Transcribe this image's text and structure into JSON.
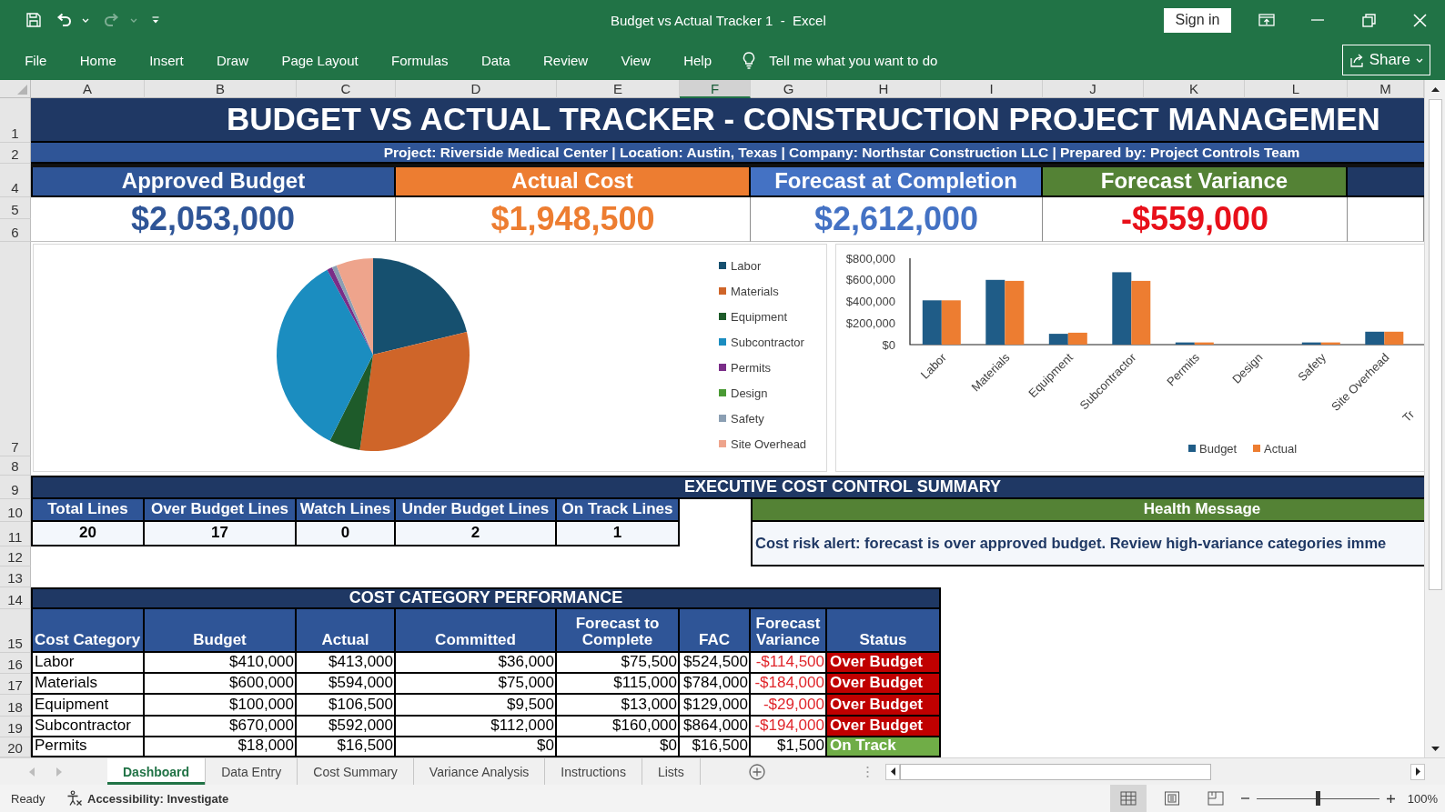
{
  "window": {
    "quick_access": [
      {
        "kind": "save",
        "disabled": false
      },
      {
        "kind": "undo",
        "disabled": false
      },
      {
        "kind": "redo",
        "disabled": true
      },
      {
        "kind": "customize",
        "disabled": false
      }
    ],
    "title": "Budget vs Actual Tracker 1  -  Excel",
    "sign_in": "Sign in"
  },
  "ribbon": {
    "tabs": [
      "File",
      "Home",
      "Insert",
      "Draw",
      "Page Layout",
      "Formulas",
      "Data",
      "Review",
      "View",
      "Help"
    ],
    "tell_me": "Tell me what you want to do",
    "share": "Share"
  },
  "columns": [
    {
      "label": "A",
      "selected": false
    },
    {
      "label": "B",
      "selected": false
    },
    {
      "label": "C",
      "selected": false
    },
    {
      "label": "D",
      "selected": false
    },
    {
      "label": "E",
      "selected": false
    },
    {
      "label": "F",
      "selected": true
    },
    {
      "label": "G",
      "selected": false
    },
    {
      "label": "H",
      "selected": false
    },
    {
      "label": "I",
      "selected": false
    },
    {
      "label": "J",
      "selected": false
    },
    {
      "label": "K",
      "selected": false
    },
    {
      "label": "L",
      "selected": false
    },
    {
      "label": "M",
      "selected": false
    }
  ],
  "row_numbers": [
    "1",
    "2",
    "4",
    "5",
    "6",
    "7",
    "8",
    "9",
    "10",
    "11",
    "12",
    "13",
    "14",
    "15",
    "16",
    "17",
    "18",
    "19",
    "20"
  ],
  "title": "BUDGET VS ACTUAL TRACKER - CONSTRUCTION PROJECT MANAGEMEN",
  "subtitle": "Project: Riverside Medical Center | Location: Austin, Texas | Company: Northstar Construction LLC | Prepared by: Project Controls Team",
  "kpis": [
    {
      "label": "Approved Budget",
      "color": "#2f5597",
      "value": {
        "text": "$2,053,000",
        "color": "#2f5597"
      }
    },
    {
      "label": "Actual Cost",
      "color": "#ed7d31",
      "value": {
        "text": "$1,948,500",
        "color": "#ed7d31"
      }
    },
    {
      "label": "Forecast at Completion",
      "color": "#4472c4",
      "value": {
        "text": "$2,612,000",
        "color": "#4472c4"
      }
    },
    {
      "label": "Forecast Variance",
      "color": "#548235",
      "value": {
        "text": "-$559,000",
        "color": "#e8101a"
      }
    },
    {
      "color": "#1f3864"
    }
  ],
  "pie_chart": {
    "chart_data": {
      "type": "pie",
      "categories": [
        "Labor",
        "Materials",
        "Equipment",
        "Subcontractor",
        "Permits",
        "Design",
        "Safety",
        "Site Overhead"
      ],
      "values": [
        21.2,
        31.0,
        5.2,
        34.7,
        0.9,
        0,
        0.8,
        6.2
      ],
      "colors": [
        "#16506f",
        "#cf6529",
        "#1e5b2a",
        "#1b8dc0",
        "#7a2d88",
        "#4a9a34",
        "#8b9fb3",
        "#eea48c"
      ],
      "legend": "right"
    }
  },
  "bar_chart": {
    "chart_data": {
      "type": "bar",
      "categories": [
        "Labor",
        "Materials",
        "Equipment",
        "Subcontractor",
        "Permits",
        "Design",
        "Safety",
        "Site Overhead"
      ],
      "series": [
        {
          "name": "Budget",
          "color": "#1f5c87",
          "values": [
            410000,
            600000,
            100000,
            670000,
            20000,
            0,
            20000,
            120000
          ]
        },
        {
          "name": "Actual",
          "color": "#ed7d31",
          "values": [
            410000,
            590000,
            110000,
            590000,
            20000,
            0,
            20000,
            120000
          ]
        }
      ],
      "ylim": [
        0,
        800000
      ],
      "yticks": [
        {
          "value": 0,
          "label": "$0"
        },
        {
          "value": 200000,
          "label": "$200,000"
        },
        {
          "value": 400000,
          "label": "$400,000"
        },
        {
          "value": 600000,
          "label": "$600,000"
        },
        {
          "value": 800000,
          "label": "$800,000"
        }
      ],
      "legend": "bottom",
      "annotations": [
        "Tr"
      ]
    }
  },
  "summary": {
    "title": "EXECUTIVE COST CONTROL SUMMARY",
    "columns": [
      "Total Lines",
      "Over Budget Lines",
      "Watch Lines",
      "Under Budget Lines",
      "On Track Lines"
    ],
    "values": [
      "20",
      "17",
      "0",
      "2",
      "1"
    ],
    "health_title": "Health Message",
    "health_message": "Cost risk alert: forecast is over approved budget. Review high-variance categories imme"
  },
  "performance": {
    "title": "COST CATEGORY PERFORMANCE",
    "columns": [
      "Cost Category",
      "Budget",
      "Actual",
      "Committed",
      "Forecast to Complete",
      "FAC",
      "Forecast Variance",
      "Status"
    ],
    "rows": [
      {
        "cells": [
          "Labor",
          "$410,000",
          "$413,000",
          "$36,000",
          "$75,500",
          "$524,500",
          "-$114,500"
        ],
        "variance_negative": true,
        "status": "Over Budget",
        "kind": "over_budget"
      },
      {
        "cells": [
          "Materials",
          "$600,000",
          "$594,000",
          "$75,000",
          "$115,000",
          "$784,000",
          "-$184,000"
        ],
        "variance_negative": true,
        "status": "Over Budget",
        "kind": "over_budget"
      },
      {
        "cells": [
          "Equipment",
          "$100,000",
          "$106,500",
          "$9,500",
          "$13,000",
          "$129,000",
          "-$29,000"
        ],
        "variance_negative": true,
        "status": "Over Budget",
        "kind": "over_budget"
      },
      {
        "cells": [
          "Subcontractor",
          "$670,000",
          "$592,000",
          "$112,000",
          "$160,000",
          "$864,000",
          "-$194,000"
        ],
        "variance_negative": true,
        "status": "Over Budget",
        "kind": "over_budget"
      },
      {
        "cells": [
          "Permits",
          "$18,000",
          "$16,500",
          "$0",
          "$0",
          "$16,500",
          "$1,500"
        ],
        "variance_negative": false,
        "status": "On Track",
        "kind": "on_track"
      }
    ]
  },
  "sheet_tabs": [
    {
      "label": "Dashboard",
      "selected": true
    },
    {
      "label": "Data Entry",
      "selected": false
    },
    {
      "label": "Cost Summary",
      "selected": false
    },
    {
      "label": "Variance Analysis",
      "selected": false
    },
    {
      "label": "Instructions",
      "selected": false
    },
    {
      "label": "Lists",
      "selected": false
    }
  ],
  "status_bar": {
    "status": "Ready",
    "accessibility": "Accessibility: Investigate",
    "views": [
      {
        "kind": "normal",
        "selected": true
      },
      {
        "kind": "page_layout",
        "selected": false
      },
      {
        "kind": "page_break",
        "selected": false
      }
    ],
    "zoom": {
      "level": 0.5,
      "reading": "100%"
    }
  }
}
